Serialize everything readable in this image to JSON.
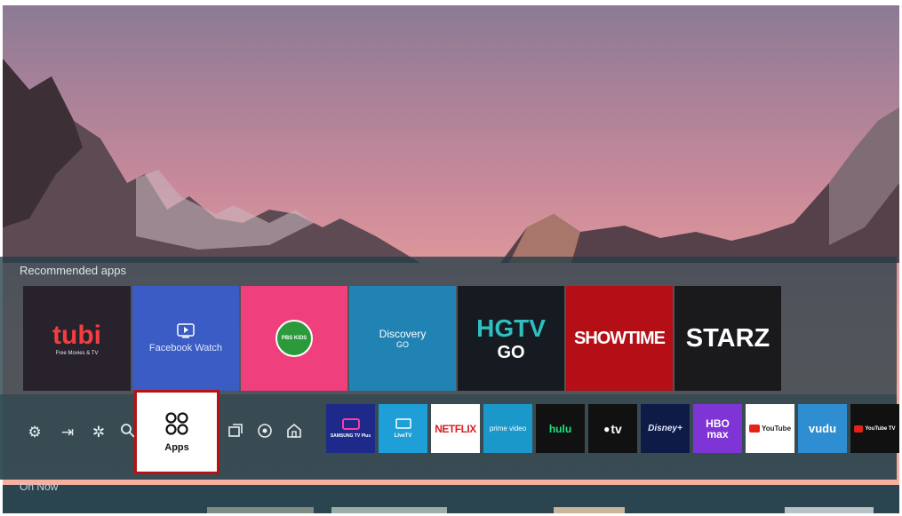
{
  "recommended": {
    "title": "Recommended apps",
    "tiles": [
      {
        "id": "tubi",
        "name": "tubi",
        "sub": "Free Movies & TV"
      },
      {
        "id": "facebook",
        "name": "Facebook Watch"
      },
      {
        "id": "pbs",
        "name": "PBS KIDS"
      },
      {
        "id": "discovery",
        "name": "Discovery",
        "sub": "GO"
      },
      {
        "id": "hgtv",
        "name": "HGTV",
        "sub": "GO"
      },
      {
        "id": "showtime",
        "name": "SHOWTIME"
      },
      {
        "id": "starz",
        "name": "STARZ"
      }
    ]
  },
  "nav": {
    "icons": [
      "settings-icon",
      "source-icon",
      "ambient-icon",
      "search-icon"
    ],
    "apps_label": "Apps",
    "right_icons": [
      "multiview-icon",
      "gaming-hub-icon",
      "home-icon"
    ]
  },
  "apps_row": [
    {
      "label": "SAMSUNG TV Plus",
      "bg": "#1d2a8a"
    },
    {
      "label": "LiveTV",
      "bg": "#1e9fd8"
    },
    {
      "label": "NETFLIX",
      "bg": "#ffffff"
    },
    {
      "label": "prime video",
      "bg": "#1a98c9"
    },
    {
      "label": "hulu",
      "bg": "#111111"
    },
    {
      "label": "tv",
      "bg": "#111111"
    },
    {
      "label": "Disney+",
      "bg": "#0f1b47"
    },
    {
      "label": "HBO max",
      "bg": "#7f34d6"
    },
    {
      "label": "YouTube",
      "bg": "#ffffff"
    },
    {
      "label": "vudu",
      "bg": "#2f8ed1"
    },
    {
      "label": "YouTube TV",
      "bg": "#111111"
    }
  ],
  "on_now": "On Now"
}
